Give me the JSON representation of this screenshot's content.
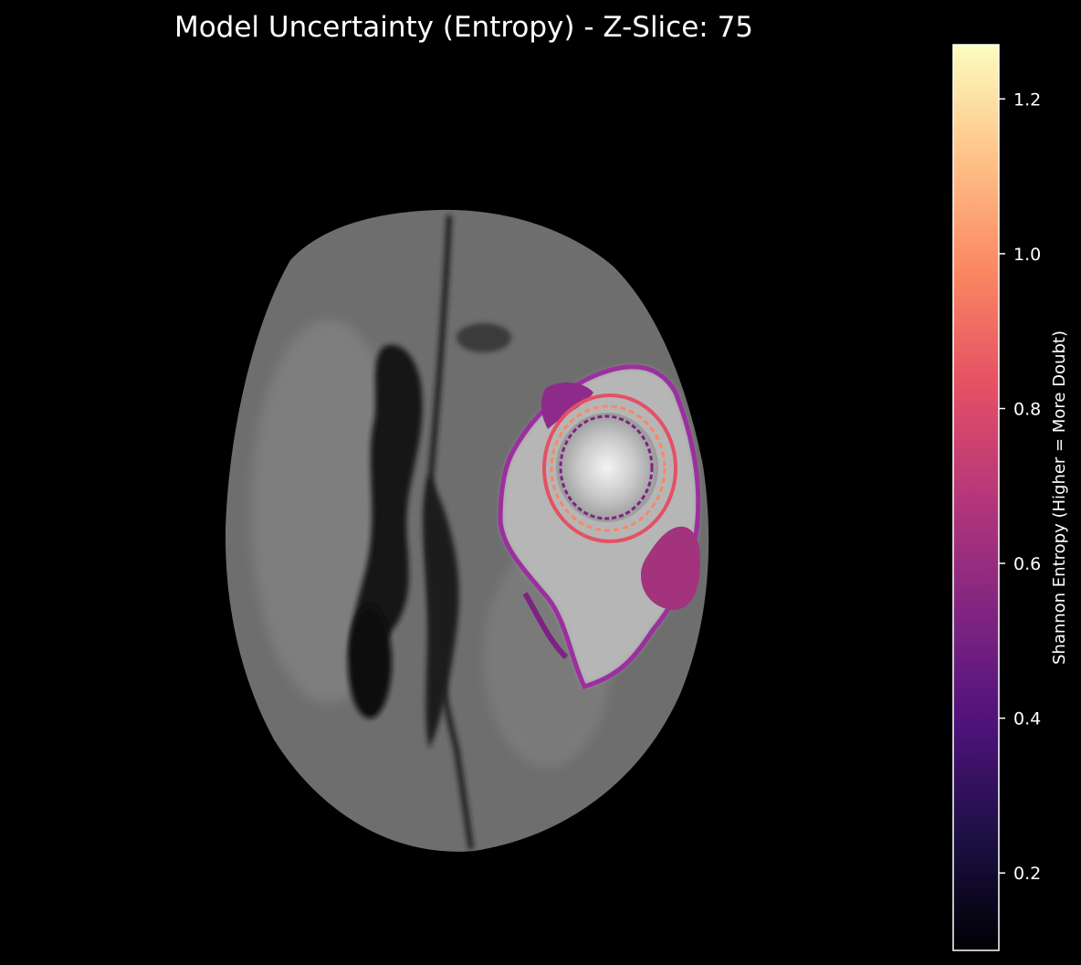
{
  "chart_data": {
    "type": "heatmap",
    "title": "Model Uncertainty (Entropy) - Z-Slice: 75",
    "axes_visible": false,
    "background": "#000000",
    "underlay": "grayscale axial brain MRI slice",
    "overlay_colormap": "magma",
    "colorbar": {
      "label": "Shannon Entropy (Higher = More Doubt)",
      "range": [
        0.1,
        1.27
      ],
      "ticks": [
        0.2,
        0.4,
        0.6,
        0.8,
        1.0,
        1.2
      ],
      "tick_labels": [
        "0.2",
        "0.4",
        "0.6",
        "0.8",
        "1.0",
        "1.2"
      ],
      "position": "right",
      "colors": [
        "#000004",
        "#1c1044",
        "#4f127b",
        "#812581",
        "#b5367a",
        "#e55064",
        "#fb8761",
        "#fec287",
        "#fcfdbf"
      ]
    },
    "uncertainty_regions": [
      {
        "region": "tumor core boundary",
        "entropy_level": "high"
      },
      {
        "region": "edema outer boundary",
        "entropy_level": "medium"
      },
      {
        "region": "lateral peritumoral patch",
        "entropy_level": "medium"
      }
    ]
  }
}
